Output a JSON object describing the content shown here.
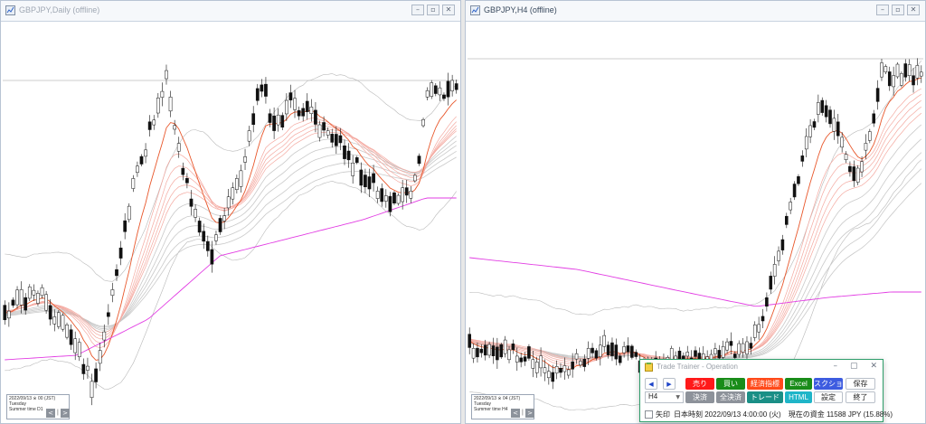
{
  "windows": {
    "left_title": "GBPJPY,Daily (offline)",
    "right_title": "GBPJPY,H4 (offline)",
    "left_info": [
      "2022/09/13 ※ 00 (JST)",
      "Tuesday",
      "Summer time",
      "D1"
    ],
    "right_info": [
      "2022/09/13 ※ 04 (JST)",
      "Tuesday",
      "Summer time",
      "H4"
    ]
  },
  "panel": {
    "title": "Trade Trainer - Operation",
    "sell": "売り",
    "buy": "買い",
    "indicators": "経済指標",
    "excel": "Excel",
    "screenshot": "スクショ",
    "save": "保存",
    "timeframe": "H4",
    "settle": "決済",
    "settle_all": "全決済",
    "trade": "トレード",
    "html": "HTML",
    "settings": "設定",
    "exit": "終了",
    "arrow_checkbox_label": "矢印",
    "status_text": "日本時刻 2022/09/13 4:00:00 (火)　現在の資金 11588 JPY (15.88%)"
  },
  "colors": {
    "sell": "#ff1a1a",
    "buy": "#198c19",
    "indicators": "#ff4a1a",
    "excel": "#198c19",
    "screenshot": "#3d5ce0",
    "settle": "#8d929a",
    "trade": "#1a8f86",
    "html": "#1fb5c8",
    "candle": "#111111",
    "ema_fast": "#e8572b",
    "ma_long": "#e23de3"
  }
}
